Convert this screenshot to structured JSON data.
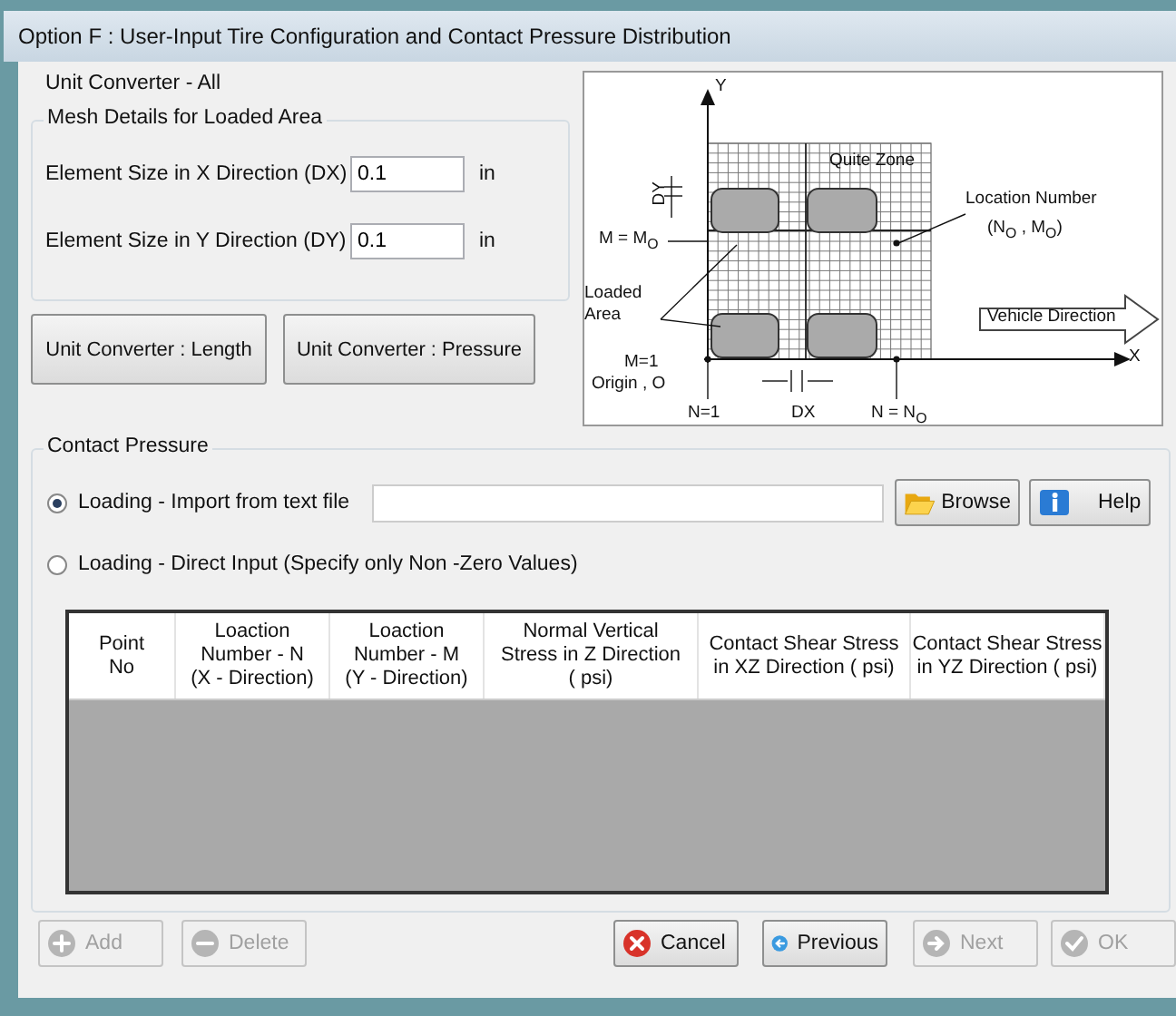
{
  "window": {
    "title": "Option F : User-Input Tire Configuration and Contact Pressure Distribution"
  },
  "unit_converter_all": "Unit Converter - All",
  "mesh": {
    "title": "Mesh Details for Loaded Area",
    "fields": [
      {
        "label": "Element Size in X Direction (DX)",
        "value": "0.1",
        "unit": "in"
      },
      {
        "label": "Element Size in Y Direction (DY)",
        "value": "0.1",
        "unit": "in"
      }
    ]
  },
  "converter_buttons": [
    "Unit Converter : Length",
    "Unit Converter : Pressure"
  ],
  "diagram": {
    "labels": [
      "Y",
      "Quite Zone",
      "DY",
      "Location Number",
      "(N$_{O}$ , M$_{O}$)",
      "M = M$_{O}$",
      "Loaded",
      "Area",
      "Vehicle Direction",
      "X",
      "M=1",
      "Origin , O",
      "N=1",
      "DX",
      "N = N$_{O}$"
    ]
  },
  "contact_pressure": {
    "title": "Contact Pressure",
    "options": [
      {
        "label": "Loading - Import from text file",
        "selected": true
      },
      {
        "label": "Loading - Direct Input (Specify only Non -Zero Values)",
        "selected": false
      }
    ],
    "browse": "Browse",
    "help": "Help",
    "table": {
      "columns": [
        "Point\nNo",
        "Loaction\nNumber - N\n(X - Direction)",
        "Loaction\nNumber - M\n(Y - Direction)",
        "Normal Vertical\nStress in Z Direction\n( psi)",
        "Contact Shear Stress\nin XZ Direction ( psi)",
        "Contact Shear Stress\nin YZ Direction ( psi)"
      ]
    }
  },
  "footer_buttons": [
    {
      "label": "Add",
      "disabled": true
    },
    {
      "label": "Delete",
      "disabled": true
    },
    {
      "label": "Cancel",
      "disabled": false
    },
    {
      "label": "Previous",
      "disabled": false
    },
    {
      "label": "Next",
      "disabled": true
    },
    {
      "label": "OK",
      "disabled": true
    }
  ]
}
